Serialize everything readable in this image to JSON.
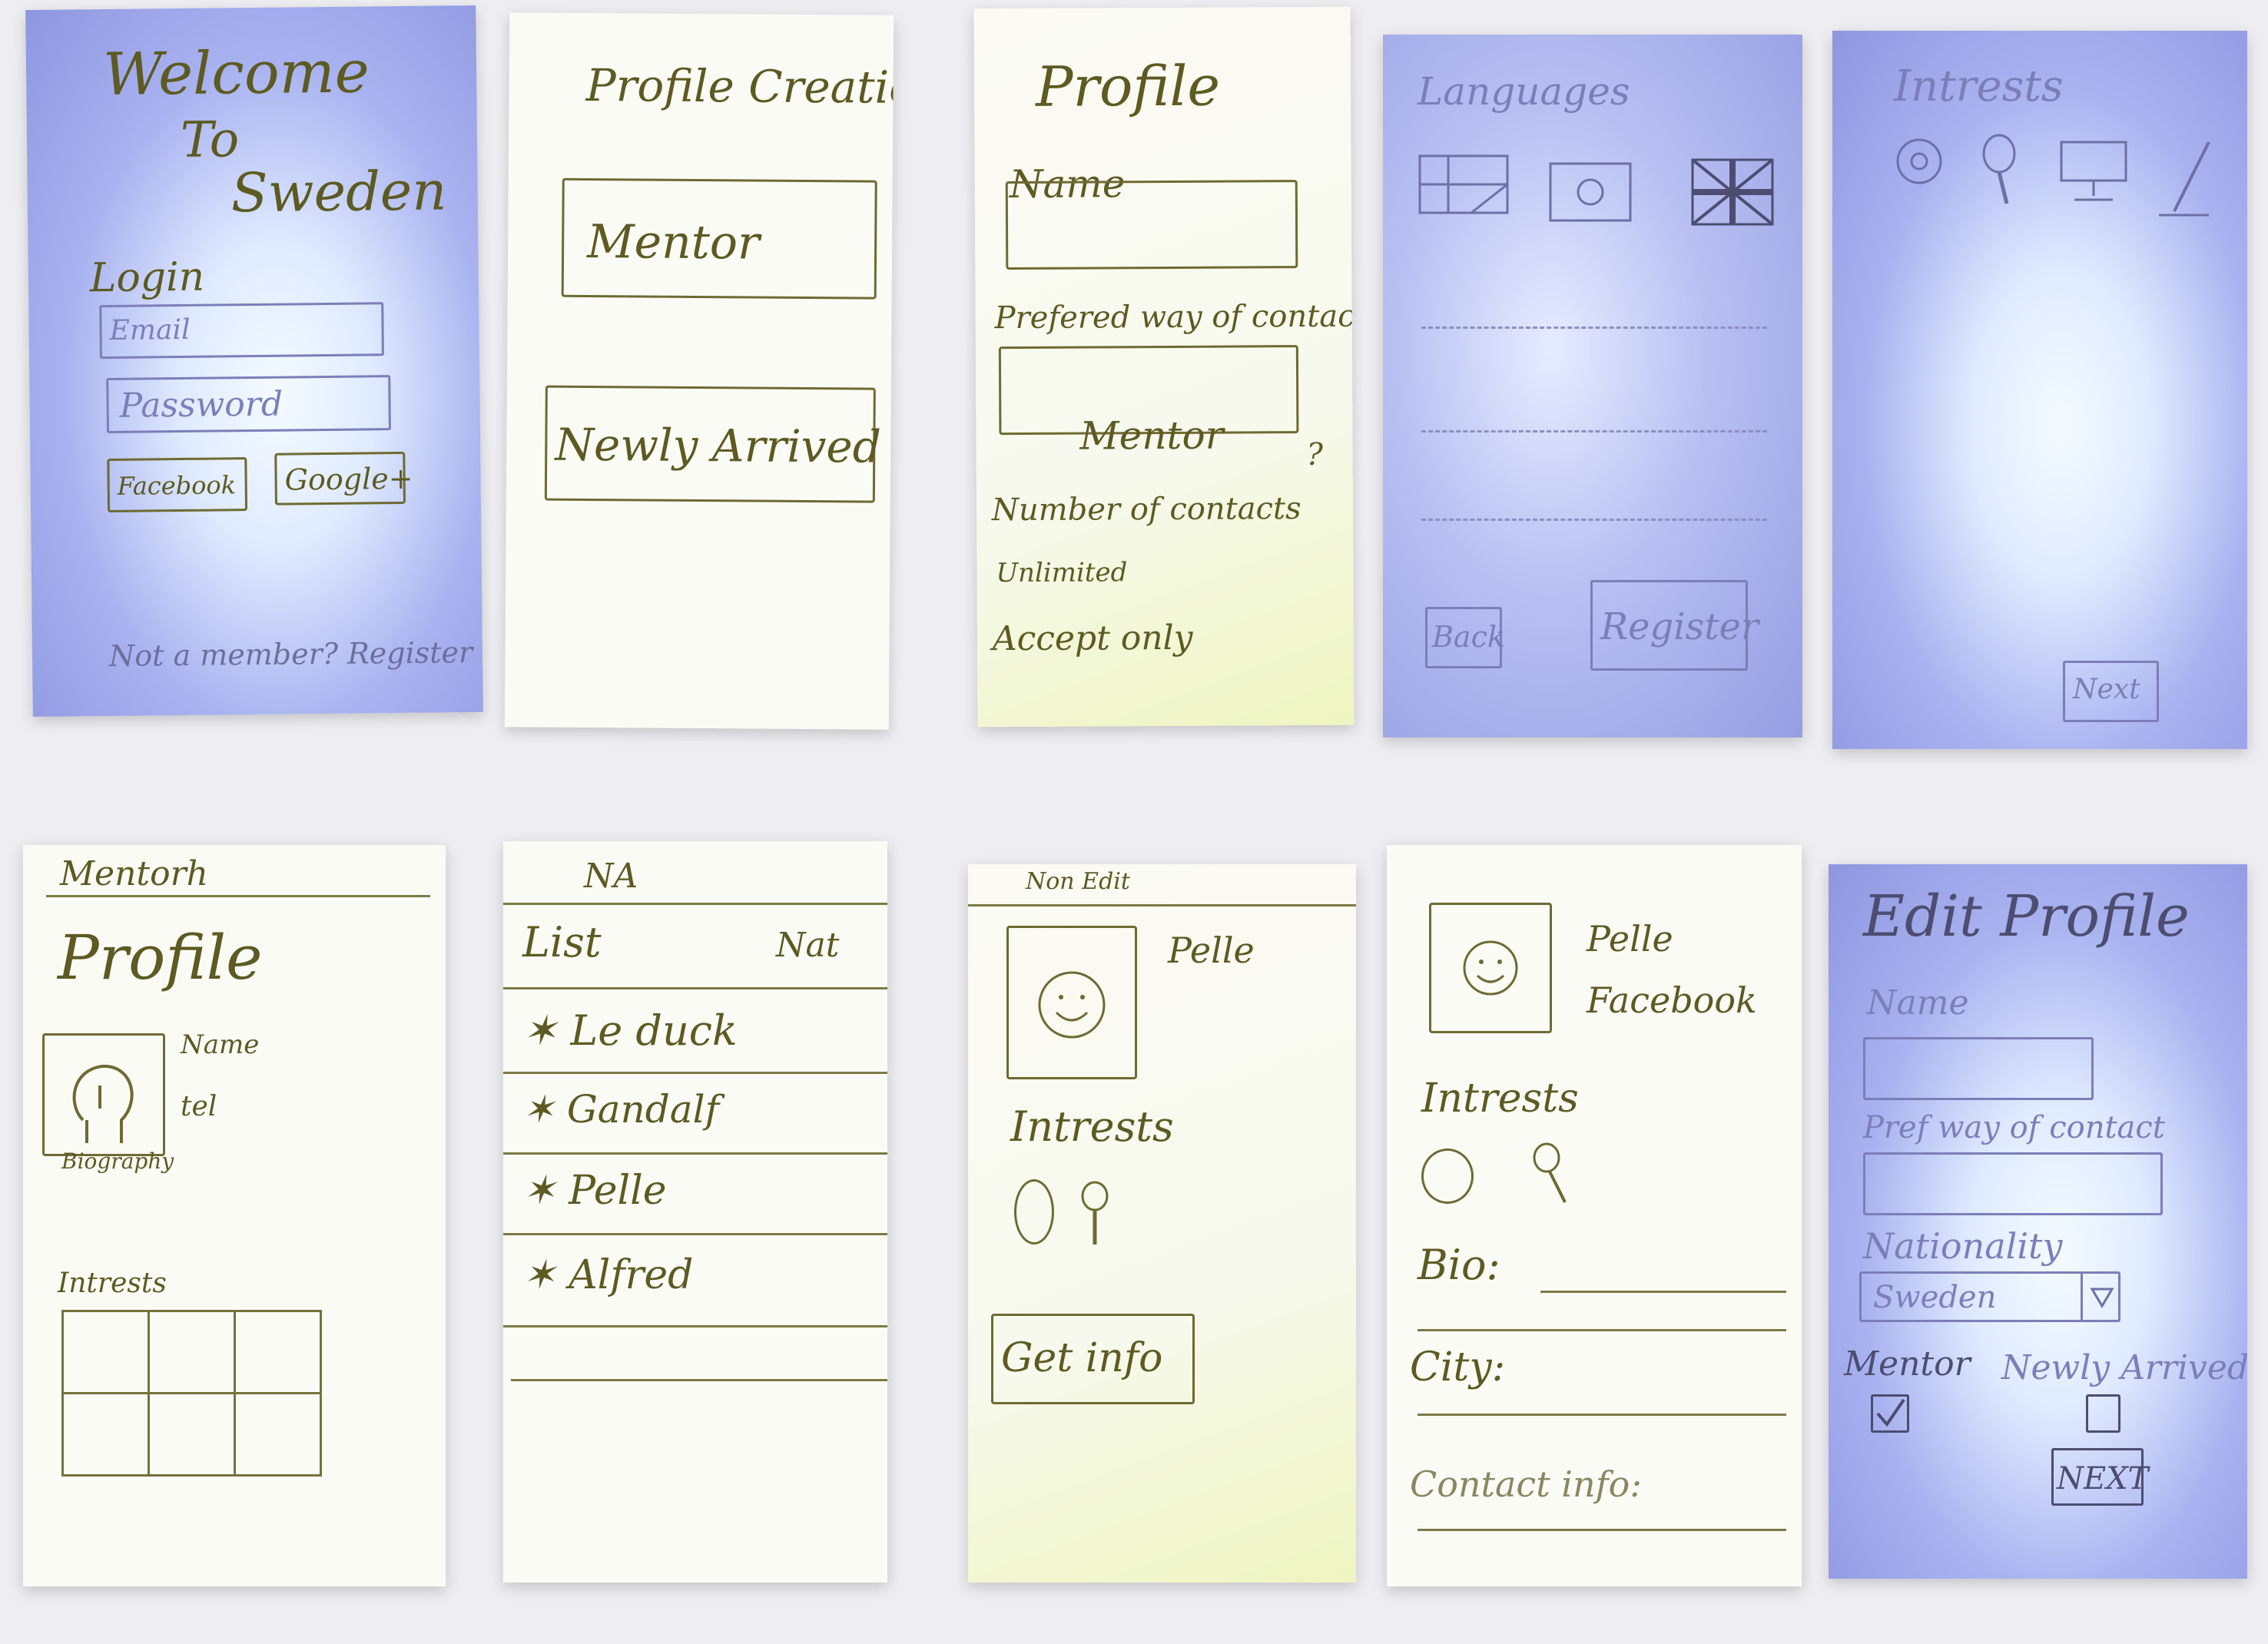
{
  "screens": {
    "welcome": {
      "title_1": "Welcome",
      "title_2": "To",
      "title_3": "Sweden",
      "login_label": "Login",
      "email_placeholder": "Email",
      "password_placeholder": "Password",
      "facebook_label": "Facebook",
      "google_label": "Google+",
      "register_text": "Not a member? Register"
    },
    "profile_creation": {
      "title": "Profile Creation",
      "mentor_label": "Mentor",
      "newly_arrived_label": "Newly Arrived"
    },
    "profile": {
      "title": "Profile",
      "name_label": "Name",
      "contact_label": "Prefered way of contact",
      "mentor_label": "Mentor",
      "question_mark": "?",
      "contacts_label": "Number of contacts",
      "unlimited_label": "Unlimited",
      "accept_label": "Accept only"
    },
    "languages": {
      "title": "Languages",
      "back_label": "Back",
      "register_label": "Register"
    },
    "interests": {
      "title": "Intrests",
      "next_label": "Next"
    },
    "mentor_profile": {
      "header": "Mentorh",
      "title": "Profile",
      "name_label": "Name",
      "tel_label": "tel",
      "bio_label": "Biography",
      "interests_label": "Intrests"
    },
    "na_list": {
      "header": "NA",
      "list_label": "List",
      "nat_label": "Nat",
      "items": [
        "Le duck",
        "Gandalf",
        "Pelle",
        "Alfred"
      ]
    },
    "non_edit": {
      "header": "Non Edit",
      "name": "Pelle",
      "interests_label": "Intrests",
      "get_info_label": "Get info"
    },
    "detail": {
      "name": "Pelle",
      "facebook_label": "Facebook",
      "interests_label": "Intrests",
      "bio_label": "Bio:",
      "city_label": "City:",
      "contact_label": "Contact info:"
    },
    "edit_profile": {
      "title": "Edit Profile",
      "name_label": "Name",
      "contact_label": "Pref way of contact",
      "nationality_label": "Nationality",
      "nationality_value": "Sweden",
      "mentor_label": "Mentor",
      "newly_arrived_label": "Newly Arrived",
      "next_label": "NEXT"
    }
  },
  "colors": {
    "pencil": "#5d5a22",
    "paper": "#fbfbf6",
    "blue_tint": "#9aa3e6"
  }
}
